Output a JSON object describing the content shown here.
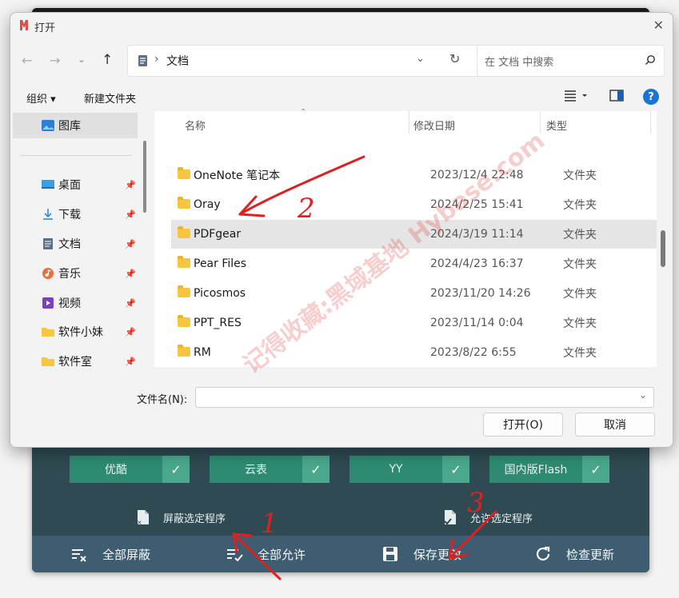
{
  "background_app": {
    "chips": [
      {
        "label": "优酷"
      },
      {
        "label": "云表"
      },
      {
        "label": "YY"
      },
      {
        "label": "国内版Flash"
      }
    ],
    "actions": {
      "block_selected": "屏蔽选定程序",
      "allow_selected": "允许选定程序"
    },
    "bottom_buttons": {
      "block_all": "全部屏蔽",
      "allow_all": "全部允许",
      "save": "保存更改",
      "check_update": "检查更新"
    }
  },
  "dialog": {
    "title": "打开",
    "address": {
      "separator": "›",
      "location": "文档"
    },
    "search": {
      "placeholder": "在 文档 中搜索"
    },
    "toolbar": {
      "organize": "组织 ▾",
      "new_folder": "新建文件夹"
    },
    "sidebar": {
      "items": [
        {
          "label": "图库",
          "icon": "gallery-icon"
        },
        {
          "label": "桌面",
          "icon": "desktop-icon"
        },
        {
          "label": "下载",
          "icon": "download-icon"
        },
        {
          "label": "文档",
          "icon": "document-icon"
        },
        {
          "label": "音乐",
          "icon": "music-icon"
        },
        {
          "label": "视频",
          "icon": "video-icon"
        },
        {
          "label": "软件小妹",
          "icon": "folder-icon"
        },
        {
          "label": "软件室",
          "icon": "folder-icon"
        }
      ]
    },
    "columns": {
      "name": "名称",
      "modified": "修改日期",
      "type": "类型"
    },
    "files": [
      {
        "name": "OneNote 笔记本",
        "modified": "2023/12/4 22:48",
        "type": "文件夹"
      },
      {
        "name": "Oray",
        "modified": "2024/2/25 15:41",
        "type": "文件夹"
      },
      {
        "name": "PDFgear",
        "modified": "2024/3/19 11:14",
        "type": "文件夹"
      },
      {
        "name": "Pear Files",
        "modified": "2024/4/23 16:37",
        "type": "文件夹"
      },
      {
        "name": "Picosmos",
        "modified": "2023/11/20 14:26",
        "type": "文件夹"
      },
      {
        "name": "PPT_RES",
        "modified": "2023/11/14 0:04",
        "type": "文件夹"
      },
      {
        "name": "RM",
        "modified": "2023/8/22 6:55",
        "type": "文件夹"
      }
    ],
    "filename_label": "文件名(N):",
    "filename_value": "",
    "open_button": "打开(O)",
    "cancel_button": "取消"
  },
  "annotations": {
    "arrow1": "1",
    "arrow2": "2",
    "arrow3": "3",
    "watermark": "记得收藏:黑域基地 Hybase.com"
  },
  "colors": {
    "accent_green": "#2e8b72",
    "bottom_bar": "#3e5d70",
    "annotation_red": "#e02020"
  }
}
